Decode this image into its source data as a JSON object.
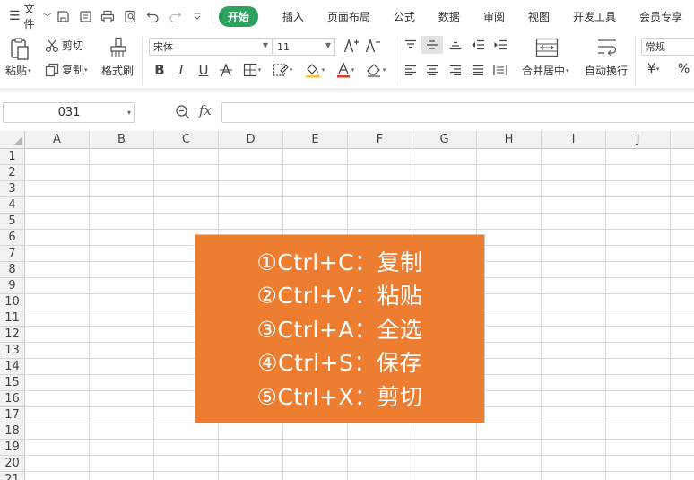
{
  "menubar": {
    "file_label": "文件",
    "tabs": [
      "开始",
      "插入",
      "页面布局",
      "公式",
      "数据",
      "审阅",
      "视图",
      "开发工具",
      "会员专享"
    ],
    "active_tab": "开始"
  },
  "ribbon": {
    "paste_label": "粘贴",
    "cut_label": "剪切",
    "copy_label": "复制",
    "format_painter_label": "格式刷",
    "font_name": "宋体",
    "font_size": "11",
    "bold_label": "B",
    "italic_label": "I",
    "underline_label": "U",
    "merge_center_label": "合并居中",
    "wrap_text_label": "自动换行",
    "number_format": "常规",
    "currency_symbol": "¥",
    "percent_symbol": "%"
  },
  "formula_bar": {
    "name_box": "031",
    "fx_label": "fx",
    "formula": ""
  },
  "sheet": {
    "columns": [
      "A",
      "B",
      "C",
      "D",
      "E",
      "F",
      "G",
      "H",
      "I",
      "J"
    ],
    "rows": [
      "1",
      "2",
      "3",
      "4",
      "5",
      "6",
      "7",
      "8",
      "9",
      "10",
      "11",
      "12",
      "13",
      "14",
      "15",
      "16",
      "17",
      "18",
      "19",
      "20",
      "21"
    ]
  },
  "shortcuts": [
    "①Ctrl+C：复制",
    "②Ctrl+V：粘贴",
    "③Ctrl+A：全选",
    "④Ctrl+S：保存",
    "⑤Ctrl+X：剪切"
  ],
  "colors": {
    "accent_tab": "#2ea360",
    "shortcut_box": "#ed7d31"
  }
}
